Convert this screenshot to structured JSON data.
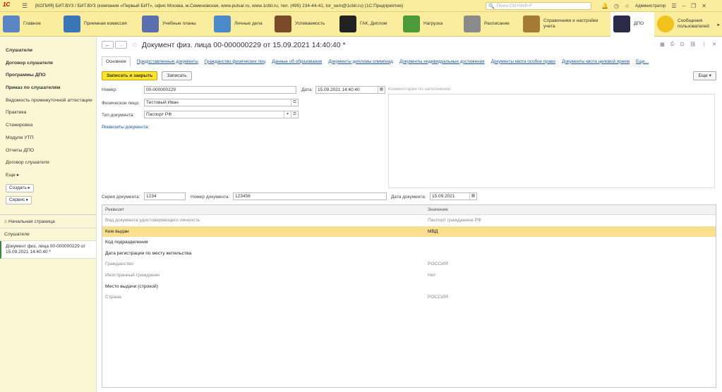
{
  "titlebar": {
    "logo": "1С",
    "title": "[КОПИЯ] БИТ.ВУЗ / БИТ.ВУЗ (компания «Первый БИТ», офис Москва, м.Семеновская, www.pulsar.ru, www.1cbit.ru, тел. (495) 234-44-41, tor_sem@1cbit.ru) (1С:Предприятие)",
    "search_placeholder": "Поиск Ctrl+Shift+F",
    "user": "Администратор"
  },
  "sections": [
    {
      "label": "Главное",
      "color": "#5a86c4"
    },
    {
      "label": "Приемная комиссия",
      "color": "#3a75b8"
    },
    {
      "label": "Учебные планы",
      "color": "#5b6fb0"
    },
    {
      "label": "Личные дела",
      "color": "#4a8ac8"
    },
    {
      "label": "Успеваемость",
      "color": "#7a4a2a"
    },
    {
      "label": "ГАК, Диплом",
      "color": "#222222"
    },
    {
      "label": "Нагрузка",
      "color": "#4c9a3a"
    },
    {
      "label": "Расписание",
      "color": "#8a8a8a"
    },
    {
      "label": "Справочники и настройки учета",
      "color": "#a57a35"
    },
    {
      "label": "ДПО",
      "color": "#2a2a4a"
    },
    {
      "label": "Сообщения пользователей",
      "color": "#f2c21c"
    }
  ],
  "sidebar": {
    "items": [
      {
        "label": "Слушатели",
        "bold": true
      },
      {
        "label": "Договор слушателя",
        "bold": true
      },
      {
        "label": "Программы ДПО",
        "bold": true
      },
      {
        "label": "Приказ по слушателям",
        "bold": true
      },
      {
        "label": "Ведомость промежуточной аттестации",
        "bold": false
      },
      {
        "label": "Практика",
        "bold": false
      },
      {
        "label": "Стажировка",
        "bold": false
      },
      {
        "label": "Модули УТП",
        "bold": false
      },
      {
        "label": "Отчеты ДПО",
        "bold": false
      },
      {
        "label": "Договор слушателя",
        "bold": false
      },
      {
        "label": "Еще ▸",
        "bold": false
      }
    ],
    "create_button": "Создать ▸",
    "service_button": "Сервис ▸",
    "home": "Начальная страница",
    "open_window": "Слушатели",
    "current_doc": "Документ физ. лица 00-000000229 от 15.09.2021 14:40:40 *"
  },
  "document": {
    "title": "Документ физ. лица 00-000000229 от 15.09.2021 14:40:40 *",
    "tabs": [
      "Основное",
      "Предоставленные документы",
      "Гражданство физических лиц",
      "Данные об образовании",
      "Документы дипломы олимпиад",
      "Документы индивидуальные достижения",
      "Документы квота особое право",
      "Документы квота целевой прием",
      "Еще..."
    ],
    "save_close": "Записать и закрыть",
    "save": "Записать",
    "more": "Еще ▾",
    "labels": {
      "number": "Номер:",
      "date": "Дата:",
      "person": "Физическое лицо:",
      "doc_type": "Тип документа:",
      "requisites_link": "Реквизиты документа:",
      "comments": "Комментарии по заполнению:",
      "series": "Серия документа:",
      "doc_number": "Номер документа:",
      "doc_date": "Дата документа:"
    },
    "values": {
      "number": "00-000000229",
      "date": "15.09.2021 14:40:40",
      "person": "Тестовый Иван",
      "doc_type": "Паспорт РФ",
      "series": "1234",
      "doc_number": "123456",
      "doc_date": "15.09.2021"
    }
  },
  "table": {
    "headers": [
      "Реквизит",
      "Значение"
    ],
    "rows": [
      {
        "name": "Вид документа удостоверяющего личность",
        "value": "Паспорт гражданина РФ",
        "style": "gray"
      },
      {
        "name": "Кем выдан",
        "value": "МВД",
        "style": "selected"
      },
      {
        "name": "Код подразделения",
        "value": "",
        "style": "dark"
      },
      {
        "name": "Дата регистрации по месту жительства",
        "value": "",
        "style": "dark"
      },
      {
        "name": "Гражданство",
        "value": "РОССИЯ",
        "style": "gray"
      },
      {
        "name": "Иностранный гражданин",
        "value": "Нет",
        "style": "gray"
      },
      {
        "name": "Место выдачи (строкой)",
        "value": "",
        "style": "dark"
      },
      {
        "name": "Страна",
        "value": "РОССИЯ",
        "style": "gray"
      }
    ]
  }
}
